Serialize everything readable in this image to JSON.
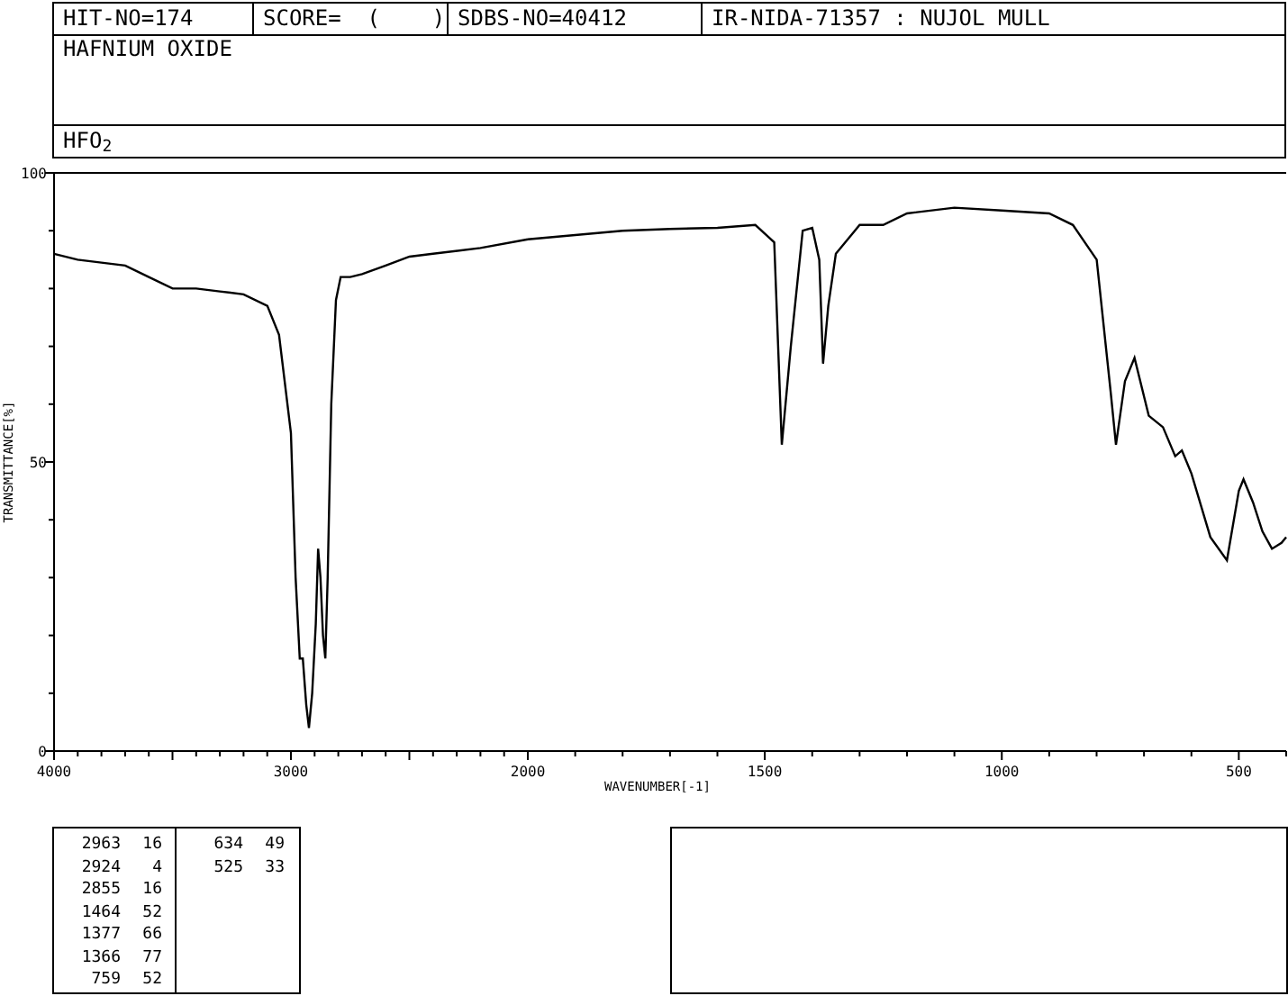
{
  "header": {
    "fields": [
      "HIT-NO=174",
      "SCORE=  (    )",
      "SDBS-NO=40412",
      "IR-NIDA-71357 : NUJOL MULL"
    ],
    "name": "HAFNIUM OXIDE",
    "formula": "HFO$_{2}$"
  },
  "spectrum_high": {
    "chart_data": {
      "type": "line",
      "ylabel": "TRANSMITTANCE[%]",
      "xlim": [
        4000,
        2000
      ],
      "ylim": [
        0,
        100
      ],
      "xticks": [
        4000,
        3000
      ],
      "yticks": [
        0,
        50,
        100
      ],
      "x": [
        4000,
        3900,
        3800,
        3700,
        3600,
        3500,
        3400,
        3300,
        3200,
        3100,
        3050,
        3000,
        2980,
        2963,
        2950,
        2935,
        2924,
        2910,
        2895,
        2885,
        2875,
        2865,
        2855,
        2845,
        2830,
        2810,
        2790,
        2750,
        2700,
        2600,
        2500,
        2400,
        2200,
        2000
      ],
      "series": [
        {
          "color": "#000000",
          "values": [
            86,
            85,
            84.5,
            84,
            82,
            80,
            80,
            79.5,
            79,
            77,
            72,
            55,
            30,
            16,
            16,
            8,
            4,
            10,
            22,
            35,
            30,
            20,
            16,
            30,
            60,
            78,
            82,
            82,
            82.5,
            84,
            85.5,
            86,
            87,
            88.5
          ]
        }
      ]
    }
  },
  "spectrum_low": {
    "chart_data": {
      "type": "line",
      "xlabel": "WAVENUMBER[-1]",
      "xlim": [
        2000,
        400
      ],
      "ylim": [
        0,
        100
      ],
      "xticks": [
        2000,
        1500,
        1000,
        500
      ],
      "x": [
        2000,
        1800,
        1700,
        1600,
        1520,
        1480,
        1464,
        1445,
        1420,
        1400,
        1385,
        1377,
        1366,
        1350,
        1300,
        1250,
        1200,
        1100,
        1000,
        900,
        850,
        800,
        770,
        759,
        740,
        720,
        690,
        660,
        634,
        620,
        600,
        560,
        525,
        500,
        490,
        470,
        450,
        430,
        410,
        400
      ],
      "series": [
        {
          "color": "#000000",
          "values": [
            88.5,
            90,
            90.3,
            90.5,
            91,
            88,
            53,
            70,
            90,
            90.5,
            85,
            67,
            77,
            86,
            91,
            91,
            93,
            94,
            93.5,
            93,
            91,
            85,
            62,
            53,
            64,
            68,
            58,
            56,
            51,
            52,
            48,
            37,
            33,
            45,
            47,
            43,
            38,
            35,
            36,
            37
          ]
        }
      ]
    }
  },
  "peak_table": {
    "columns": [
      [
        {
          "wavenumber": "2963",
          "transmittance": "16"
        },
        {
          "wavenumber": "2924",
          "transmittance": "4"
        },
        {
          "wavenumber": "2855",
          "transmittance": "16"
        },
        {
          "wavenumber": "1464",
          "transmittance": "52"
        },
        {
          "wavenumber": "1377",
          "transmittance": "66"
        },
        {
          "wavenumber": "1366",
          "transmittance": "77"
        },
        {
          "wavenumber": "759",
          "transmittance": "52"
        }
      ],
      [
        {
          "wavenumber": "634",
          "transmittance": "49"
        },
        {
          "wavenumber": "525",
          "transmittance": "33"
        }
      ]
    ]
  }
}
